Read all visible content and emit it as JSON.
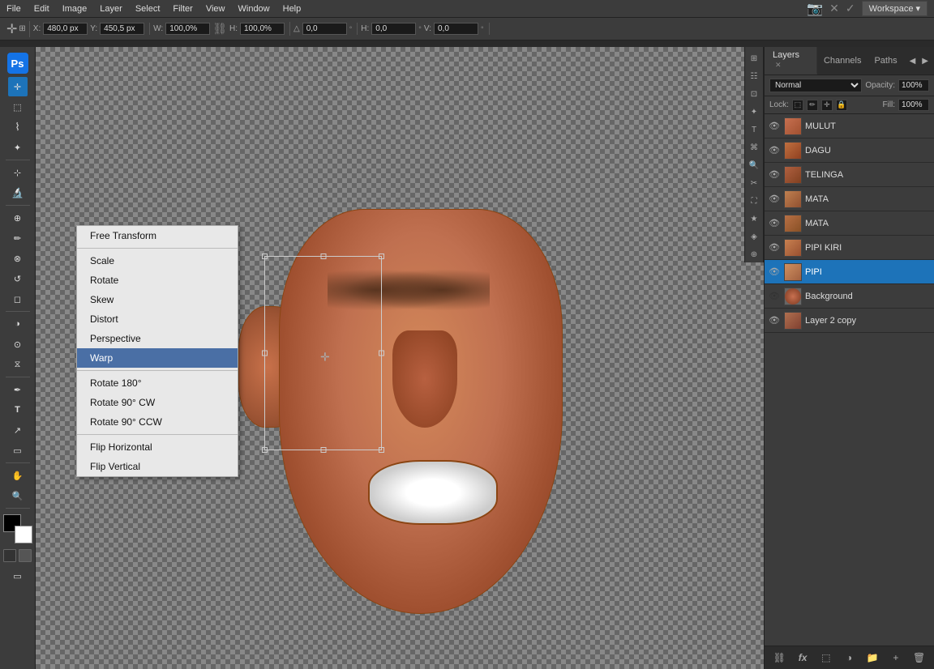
{
  "menubar": {
    "items": [
      "File",
      "Edit",
      "Image",
      "Layer",
      "Select",
      "Filter",
      "View",
      "Window",
      "Help"
    ]
  },
  "optionsbar": {
    "x_label": "X:",
    "x_value": "480,0 px",
    "y_label": "Y:",
    "y_value": "450,5 px",
    "w_label": "W:",
    "w_value": "100,0%",
    "h_label": "H:",
    "h_value": "100,0%",
    "rot_label": "△",
    "rot_value": "0,0",
    "h2_label": "H:",
    "h2_value": "0,0",
    "v_label": "V:",
    "v_value": "0,0",
    "workspace_label": "Workspace"
  },
  "contextmenu": {
    "items": [
      {
        "id": "free-transform",
        "label": "Free Transform",
        "highlighted": false,
        "separator_after": false
      },
      {
        "id": "scale",
        "label": "Scale",
        "highlighted": false,
        "separator_after": false
      },
      {
        "id": "rotate",
        "label": "Rotate",
        "highlighted": false,
        "separator_after": false
      },
      {
        "id": "skew",
        "label": "Skew",
        "highlighted": false,
        "separator_after": false
      },
      {
        "id": "distort",
        "label": "Distort",
        "highlighted": false,
        "separator_after": false
      },
      {
        "id": "perspective",
        "label": "Perspective",
        "highlighted": false,
        "separator_after": false
      },
      {
        "id": "warp",
        "label": "Warp",
        "highlighted": true,
        "separator_after": true
      },
      {
        "id": "rotate180",
        "label": "Rotate 180°",
        "highlighted": false,
        "separator_after": false
      },
      {
        "id": "rotate90cw",
        "label": "Rotate 90° CW",
        "highlighted": false,
        "separator_after": false
      },
      {
        "id": "rotate90ccw",
        "label": "Rotate 90° CCW",
        "highlighted": false,
        "separator_after": true
      },
      {
        "id": "flip-horizontal",
        "label": "Flip Horizontal",
        "highlighted": false,
        "separator_after": false
      },
      {
        "id": "flip-vertical",
        "label": "Flip Vertical",
        "highlighted": false,
        "separator_after": false
      }
    ]
  },
  "layers_panel": {
    "tabs": [
      {
        "id": "layers",
        "label": "Layers",
        "active": true
      },
      {
        "id": "channels",
        "label": "Channels",
        "active": false
      },
      {
        "id": "paths",
        "label": "Paths",
        "active": false
      }
    ],
    "blend_mode": "Normal",
    "opacity_label": "Opacity:",
    "opacity_value": "100%",
    "lock_label": "Lock:",
    "fill_label": "Fill:",
    "fill_value": "100%",
    "layers": [
      {
        "id": "mulut",
        "name": "MULUT",
        "visible": true,
        "active": false
      },
      {
        "id": "dagu",
        "name": "DAGU",
        "visible": true,
        "active": false
      },
      {
        "id": "telinga",
        "name": "TELINGA",
        "visible": true,
        "active": false
      },
      {
        "id": "mata1",
        "name": "MATA",
        "visible": true,
        "active": false
      },
      {
        "id": "mata2",
        "name": "MATA",
        "visible": true,
        "active": false
      },
      {
        "id": "pipi-kiri",
        "name": "PIPI KIRI",
        "visible": true,
        "active": false
      },
      {
        "id": "pipi",
        "name": "PIPI",
        "visible": true,
        "active": true
      },
      {
        "id": "background",
        "name": "Background",
        "visible": false,
        "active": false
      },
      {
        "id": "layer2copy",
        "name": "Layer 2 copy",
        "visible": true,
        "active": false
      }
    ]
  },
  "toolbar": {
    "tools": [
      "move",
      "rect-select",
      "lasso",
      "magic-wand",
      "crop",
      "eyedropper",
      "healing",
      "brush",
      "clone-stamp",
      "history-brush",
      "eraser",
      "gradient",
      "blur",
      "dodge",
      "pen",
      "text",
      "path-select",
      "shape",
      "hand",
      "zoom"
    ]
  },
  "colors": {
    "foreground": "#000000",
    "background": "#ffffff",
    "accent_blue": "#1d73b9",
    "panel_bg": "#3c3c3c",
    "menu_bg": "#3c3c3c"
  }
}
